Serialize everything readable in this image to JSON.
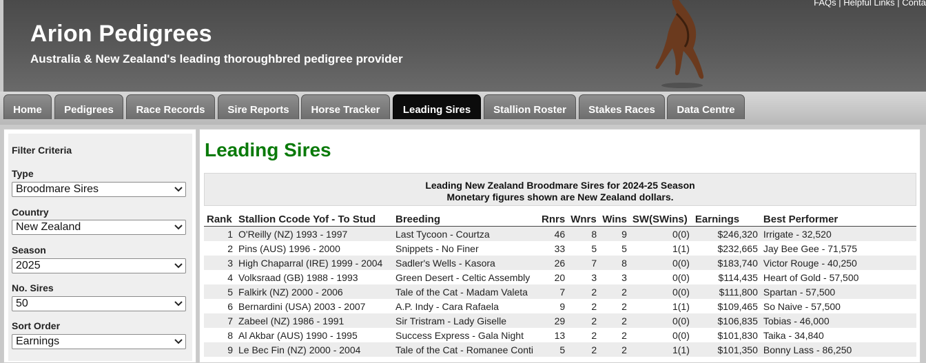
{
  "header": {
    "title": "Arion Pedigrees",
    "tagline": "Australia & New Zealand's leading thoroughbred pedigree provider",
    "top_links": [
      "FAQs",
      "Helpful Links",
      "Conta"
    ]
  },
  "nav": {
    "tabs": [
      {
        "label": "Home"
      },
      {
        "label": "Pedigrees"
      },
      {
        "label": "Race Records"
      },
      {
        "label": "Sire Reports"
      },
      {
        "label": "Horse Tracker"
      },
      {
        "label": "Leading Sires",
        "active": true
      },
      {
        "label": "Stallion Roster"
      },
      {
        "label": "Stakes Races"
      },
      {
        "label": "Data Centre"
      }
    ]
  },
  "filters": {
    "title": "Filter Criteria",
    "type": {
      "label": "Type",
      "value": "Broodmare Sires"
    },
    "country": {
      "label": "Country",
      "value": "New Zealand"
    },
    "season": {
      "label": "Season",
      "value": "2025"
    },
    "no_sires": {
      "label": "No. Sires",
      "value": "50"
    },
    "sort_order": {
      "label": "Sort Order",
      "value": "Earnings"
    }
  },
  "main": {
    "title": "Leading Sires",
    "summary_line1": "Leading New Zealand Broodmare Sires for 2024-25 Season",
    "summary_line2": "Monetary figures shown are New Zealand dollars.",
    "columns": [
      "Rank",
      "Stallion Ccode Yof - To Stud",
      "Breeding",
      "Rnrs",
      "Wnrs",
      "Wins",
      "SW(SWins)",
      "Earnings",
      "Best Performer"
    ],
    "rows": [
      [
        "1",
        "O'Reilly (NZ) 1993 - 1997",
        "Last Tycoon - Courtza",
        "46",
        "8",
        "9",
        "0(0)",
        "$246,320",
        "Irrigate - 32,520"
      ],
      [
        "2",
        "Pins (AUS) 1996 - 2000",
        "Snippets - No Finer",
        "33",
        "5",
        "5",
        "1(1)",
        "$232,665",
        "Jay Bee Gee - 71,575"
      ],
      [
        "3",
        "High Chaparral (IRE) 1999 - 2004",
        "Sadler's Wells - Kasora",
        "26",
        "7",
        "8",
        "0(0)",
        "$183,740",
        "Victor Rouge - 40,250"
      ],
      [
        "4",
        "Volksraad (GB) 1988 - 1993",
        "Green Desert - Celtic Assembly",
        "20",
        "3",
        "3",
        "0(0)",
        "$114,435",
        "Heart of Gold - 57,500"
      ],
      [
        "5",
        "Falkirk (NZ) 2000 - 2006",
        "Tale of the Cat - Madam Valeta",
        "7",
        "2",
        "2",
        "0(0)",
        "$111,800",
        "Spartan - 57,500"
      ],
      [
        "6",
        "Bernardini (USA) 2003 - 2007",
        "A.P. Indy - Cara Rafaela",
        "9",
        "2",
        "2",
        "1(1)",
        "$109,465",
        "So Naive - 57,500"
      ],
      [
        "7",
        "Zabeel (NZ) 1986 - 1991",
        "Sir Tristram - Lady Giselle",
        "29",
        "2",
        "2",
        "0(0)",
        "$106,835",
        "Tobias - 46,000"
      ],
      [
        "8",
        "Al Akbar (AUS) 1990 - 1995",
        "Success Express - Gala Night",
        "13",
        "2",
        "2",
        "0(0)",
        "$101,830",
        "Taika - 34,840"
      ],
      [
        "9",
        "Le Bec Fin (NZ) 2000 - 2004",
        "Tale of the Cat - Romanee Conti",
        "5",
        "2",
        "2",
        "1(1)",
        "$101,350",
        "Bonny Lass - 86,250"
      ]
    ]
  }
}
